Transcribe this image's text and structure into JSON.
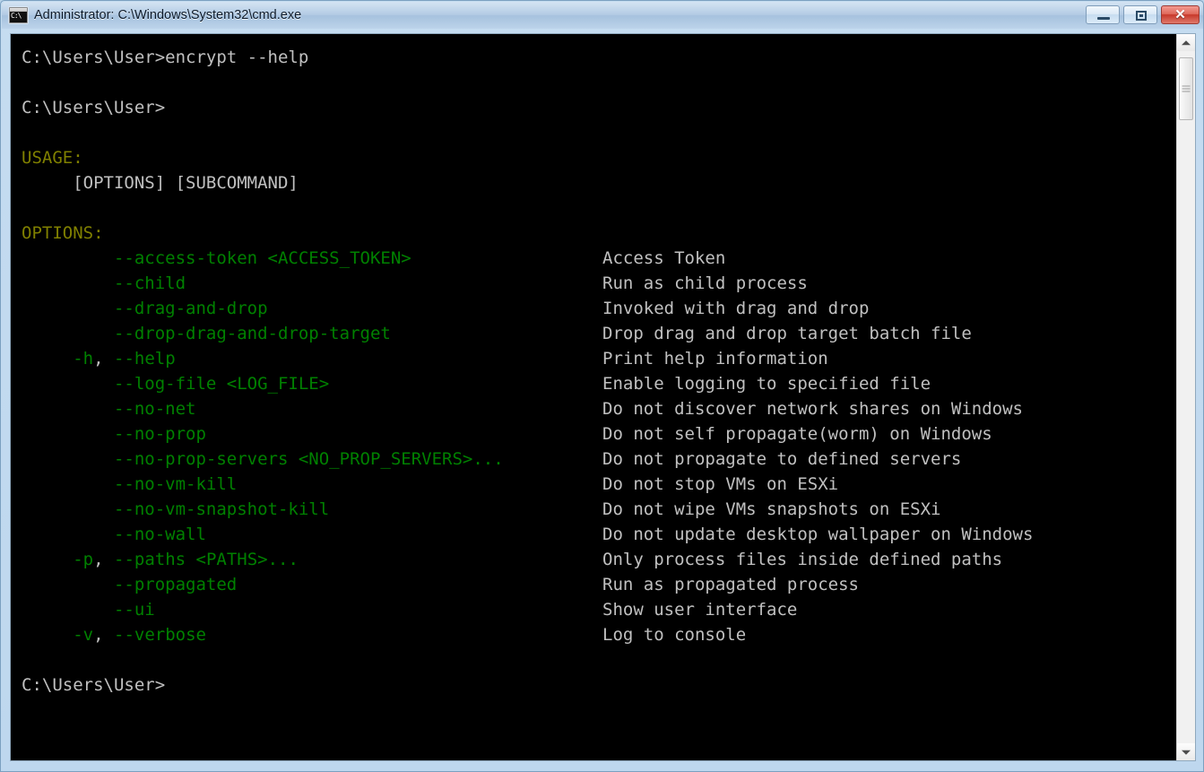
{
  "window": {
    "title": "Administrator: C:\\Windows\\System32\\cmd.exe",
    "icon": "cmd-icon",
    "icon_text": "C:\\",
    "controls": {
      "minimize_label": "",
      "maximize_label": "",
      "close_label": "✕"
    }
  },
  "console": {
    "colors": {
      "background": "#000000",
      "text": "#c0c0c0",
      "option": "#008000",
      "heading": "#808000"
    },
    "lines": [
      {
        "type": "prompt",
        "text": "C:\\Users\\User>encrypt --help",
        "color": "#c0c0c0"
      },
      {
        "type": "blank",
        "text": "",
        "color": "#c0c0c0"
      },
      {
        "type": "prompt",
        "text": "C:\\Users\\User>",
        "color": "#c0c0c0"
      },
      {
        "type": "blank",
        "text": "",
        "color": "#c0c0c0"
      },
      {
        "type": "heading",
        "text": "USAGE:",
        "color": "#808000"
      },
      {
        "type": "text",
        "text": "     [OPTIONS] [SUBCOMMAND]",
        "color": "#c0c0c0"
      },
      {
        "type": "blank",
        "text": "",
        "color": "#c0c0c0"
      },
      {
        "type": "heading",
        "text": "OPTIONS:",
        "color": "#808000"
      }
    ],
    "trailing_prompt": "C:\\Users\\User>"
  },
  "options": [
    {
      "short": "",
      "comma": "",
      "flag": "--access-token <ACCESS_TOKEN>",
      "description": "Access Token"
    },
    {
      "short": "",
      "comma": "",
      "flag": "--child",
      "description": "Run as child process"
    },
    {
      "short": "",
      "comma": "",
      "flag": "--drag-and-drop",
      "description": "Invoked with drag and drop"
    },
    {
      "short": "",
      "comma": "",
      "flag": "--drop-drag-and-drop-target",
      "description": "Drop drag and drop target batch file"
    },
    {
      "short": "-h",
      "comma": ",",
      "flag": "--help",
      "description": "Print help information"
    },
    {
      "short": "",
      "comma": "",
      "flag": "--log-file <LOG_FILE>",
      "description": "Enable logging to specified file"
    },
    {
      "short": "",
      "comma": "",
      "flag": "--no-net",
      "description": "Do not discover network shares on Windows"
    },
    {
      "short": "",
      "comma": "",
      "flag": "--no-prop",
      "description": "Do not self propagate(worm) on Windows"
    },
    {
      "short": "",
      "comma": "",
      "flag": "--no-prop-servers <NO_PROP_SERVERS>...",
      "description": "Do not propagate to defined servers"
    },
    {
      "short": "",
      "comma": "",
      "flag": "--no-vm-kill",
      "description": "Do not stop VMs on ESXi"
    },
    {
      "short": "",
      "comma": "",
      "flag": "--no-vm-snapshot-kill",
      "description": "Do not wipe VMs snapshots on ESXi"
    },
    {
      "short": "",
      "comma": "",
      "flag": "--no-wall",
      "description": "Do not update desktop wallpaper on Windows"
    },
    {
      "short": "-p",
      "comma": ",",
      "flag": "--paths <PATHS>...",
      "description": "Only process files inside defined paths"
    },
    {
      "short": "",
      "comma": "",
      "flag": "--propagated",
      "description": "Run as propagated process"
    },
    {
      "short": "",
      "comma": "",
      "flag": "--ui",
      "description": "Show user interface"
    },
    {
      "short": "-v",
      "comma": ",",
      "flag": "--verbose",
      "description": "Log to console"
    }
  ],
  "scrollbar": {
    "up_arrow": "scroll-up-arrow",
    "down_arrow": "scroll-down-arrow",
    "thumb": "scroll-thumb"
  }
}
